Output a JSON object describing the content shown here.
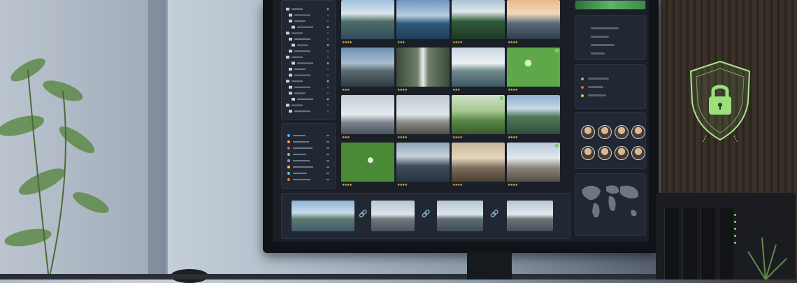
{
  "scene": {
    "description_colors": {
      "accent_green": "#7ccf6a",
      "shield_glow": "#9be07a",
      "star": "#f1c24a"
    }
  },
  "sidebar": {
    "tree_icons": [
      "folder-icon",
      "folder-icon",
      "folder-icon",
      "folder-icon",
      "folder-icon",
      "folder-icon",
      "folder-icon",
      "folder-icon",
      "folder-icon",
      "folder-icon",
      "folder-icon",
      "folder-icon",
      "folder-icon",
      "folder-icon",
      "folder-icon",
      "folder-icon",
      "folder-icon",
      "folder-icon"
    ],
    "tags_dot_colors": [
      "#4fb3ff",
      "#f0a64a",
      "#e05a6a",
      "#8ad06a",
      "#c27ce6",
      "#f0d04a",
      "#5ad0c8",
      "#e07a4a"
    ]
  },
  "grid": {
    "thumbs": [
      {
        "kind": "mountain-lake",
        "stars": "★★★★",
        "flag": false
      },
      {
        "kind": "blue-lake",
        "stars": "★★★",
        "flag": false
      },
      {
        "kind": "forest",
        "stars": "★★★★",
        "flag": false
      },
      {
        "kind": "sunset-lake",
        "stars": "★★★★",
        "flag": false
      },
      {
        "kind": "mountains",
        "stars": "★★★",
        "flag": false
      },
      {
        "kind": "waterfall",
        "stars": "★★★★",
        "flag": false
      },
      {
        "kind": "alpine",
        "stars": "★★★",
        "flag": false
      },
      {
        "kind": "water-drops",
        "stars": "★★★★",
        "flag": true
      },
      {
        "kind": "monument",
        "stars": "★★★",
        "flag": false
      },
      {
        "kind": "hiker",
        "stars": "★★★★",
        "flag": false
      },
      {
        "kind": "couple-hiking",
        "stars": "★★★★",
        "flag": true
      },
      {
        "kind": "river-valley",
        "stars": "★★★★",
        "flag": false
      },
      {
        "kind": "leaf-drops",
        "stars": "★★★★",
        "flag": false
      },
      {
        "kind": "city-street",
        "stars": "★★★★",
        "flag": false
      },
      {
        "kind": "old-town",
        "stars": "★★★★",
        "flag": false
      },
      {
        "kind": "cathedral",
        "stars": "★★★★",
        "flag": true
      }
    ]
  },
  "compare": {
    "link_icon": "🔗"
  },
  "security": {
    "icon": "lock-icon"
  }
}
